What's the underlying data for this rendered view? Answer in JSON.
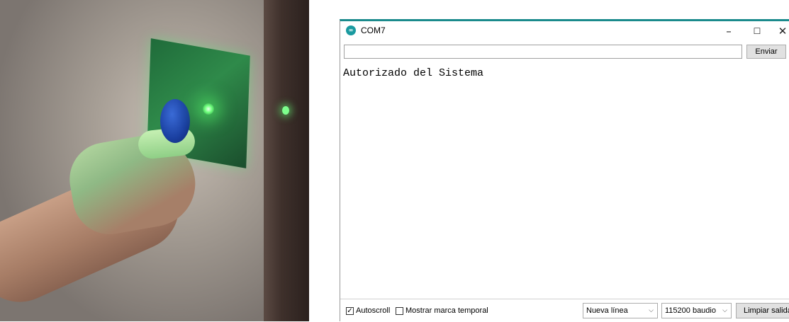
{
  "window": {
    "title": "COM7",
    "app_icon_glyph": "∞",
    "controls": {
      "minimize": "–",
      "maximize": "☐",
      "close": "✕"
    },
    "accent_color": "#1a8a8c"
  },
  "send": {
    "input_value": "",
    "button_label": "Enviar"
  },
  "output": {
    "lines": [
      "Autorizado del Sistema"
    ]
  },
  "statusbar": {
    "autoscroll": {
      "label": "Autoscroll",
      "checked": true,
      "mark": "✓"
    },
    "timestamp": {
      "label": "Mostrar marca temporal",
      "checked": false,
      "mark": ""
    },
    "line_ending": {
      "selected": "Nueva línea"
    },
    "baud": {
      "selected": "115200 baudio"
    },
    "chevron": "⌵",
    "clear_label": "Limpiar salida"
  },
  "photo": {
    "icons": [
      "rfid-reader-board",
      "green-led",
      "rfid-tag",
      "hand"
    ]
  }
}
